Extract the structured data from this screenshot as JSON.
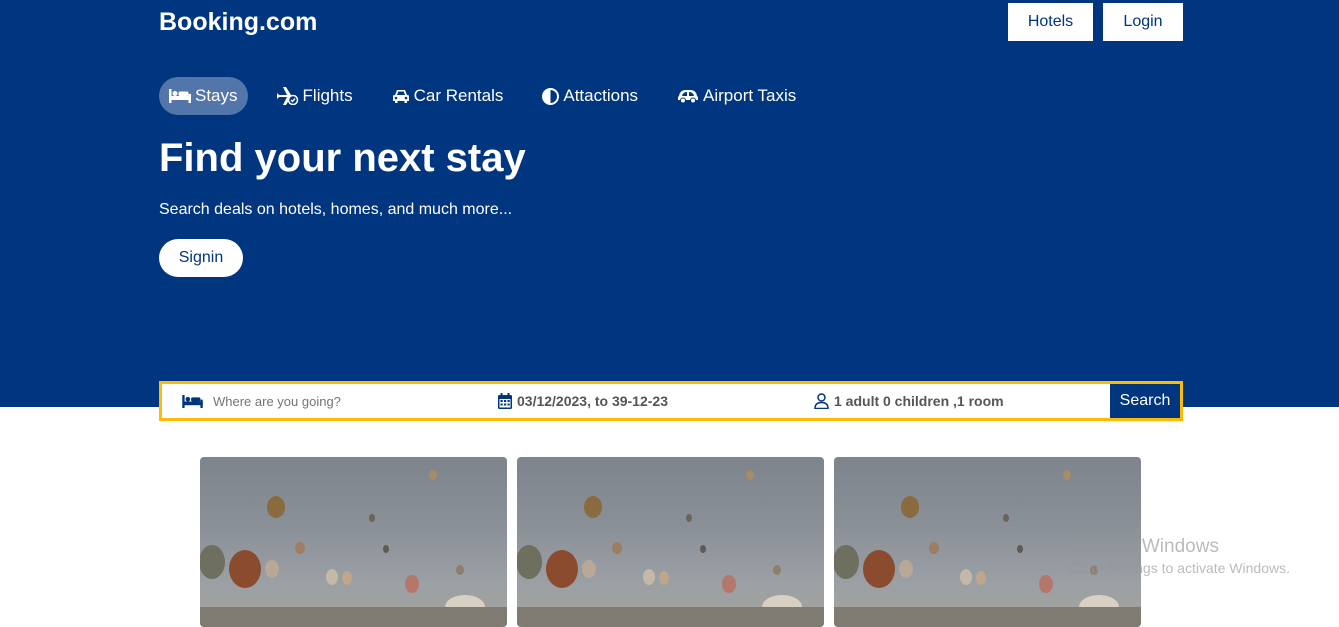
{
  "header": {
    "logo": "Booking.com",
    "hotels_label": "Hotels",
    "login_label": "Login"
  },
  "nav": {
    "items": [
      {
        "label": "Stays",
        "icon": "bed-icon",
        "active": true
      },
      {
        "label": "Flights",
        "icon": "plane-icon",
        "active": false
      },
      {
        "label": "Car Rentals",
        "icon": "car-icon",
        "active": false
      },
      {
        "label": "Attactions",
        "icon": "half-circle-icon",
        "active": false
      },
      {
        "label": "Airport Taxis",
        "icon": "taxi-icon",
        "active": false
      }
    ]
  },
  "hero": {
    "title": "Find your next stay",
    "subtitle": "Search deals on hotels, homes, and much more...",
    "signin_label": "Signin"
  },
  "search": {
    "destination_placeholder": "Where are you going?",
    "destination_value": "",
    "dates": "03/12/2023, to 39-12-23",
    "guests": "1 adult 0 children ,1 room",
    "button_label": "Search"
  },
  "colors": {
    "brand": "#003580",
    "accent": "#febb02",
    "white": "#ffffff"
  },
  "watermark": {
    "title": "Activate Windows",
    "subtitle": "Go to Settings to activate Windows."
  }
}
